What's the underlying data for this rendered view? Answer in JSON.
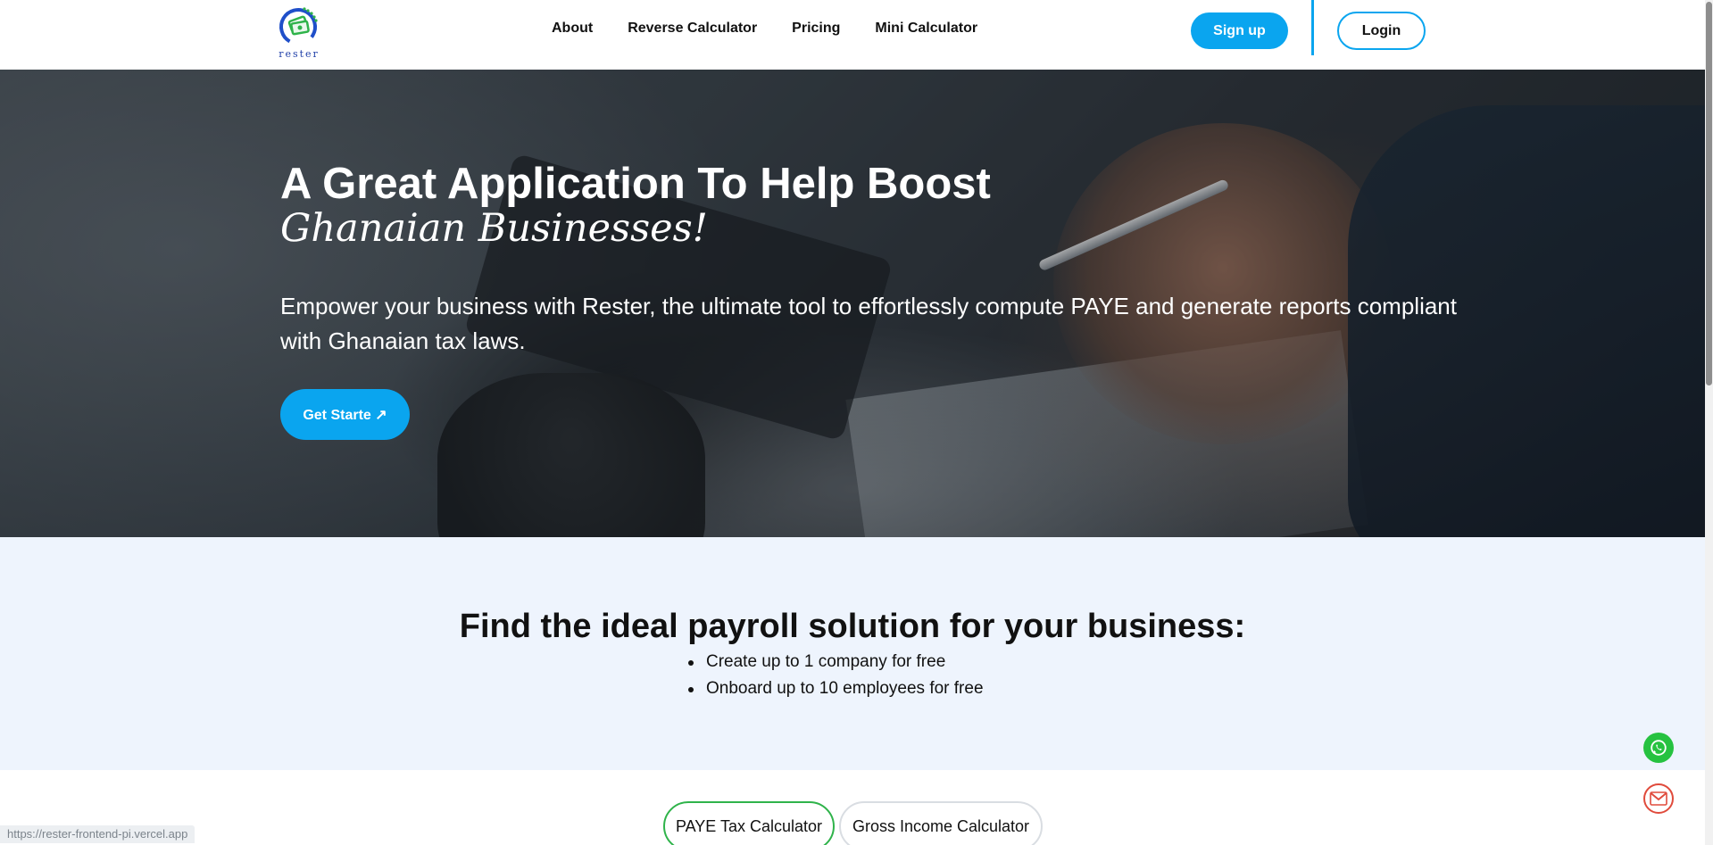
{
  "brand": {
    "name": "rester"
  },
  "nav": {
    "items": [
      {
        "label": "About"
      },
      {
        "label": "Reverse Calculator"
      },
      {
        "label": "Pricing"
      },
      {
        "label": "Mini Calculator"
      }
    ]
  },
  "auth": {
    "signup_label": "Sign up",
    "login_label": "Login"
  },
  "hero": {
    "title": "A Great Application To Help Boost",
    "title_script": "Ghanaian Businesses!",
    "description": "Empower your business with Rester, the ultimate tool to effortlessly compute PAYE and generate reports compliant with Ghanaian tax laws.",
    "cta_label": "Get Starte ↗"
  },
  "solutions": {
    "title": "Find the ideal payroll solution for your business:",
    "points": [
      "Create up to 1 company for free",
      "Onboard up to 10 employees for free"
    ]
  },
  "calculators": {
    "tabs": [
      {
        "label": "PAYE Tax Calculator",
        "active": true
      },
      {
        "label": "Gross Income Calculator",
        "active": false
      }
    ]
  },
  "contact": {
    "whatsapp_icon": "whatsapp-icon",
    "gmail_icon": "gmail-icon"
  },
  "status_bar": {
    "url": "https://rester-frontend-pi.vercel.app"
  },
  "colors": {
    "primary": "#0aa5ef",
    "whatsapp": "#26c240",
    "gmail": "#e04b3c",
    "active_tab_border": "#2fb34a",
    "section_bg": "#eef4fd"
  }
}
